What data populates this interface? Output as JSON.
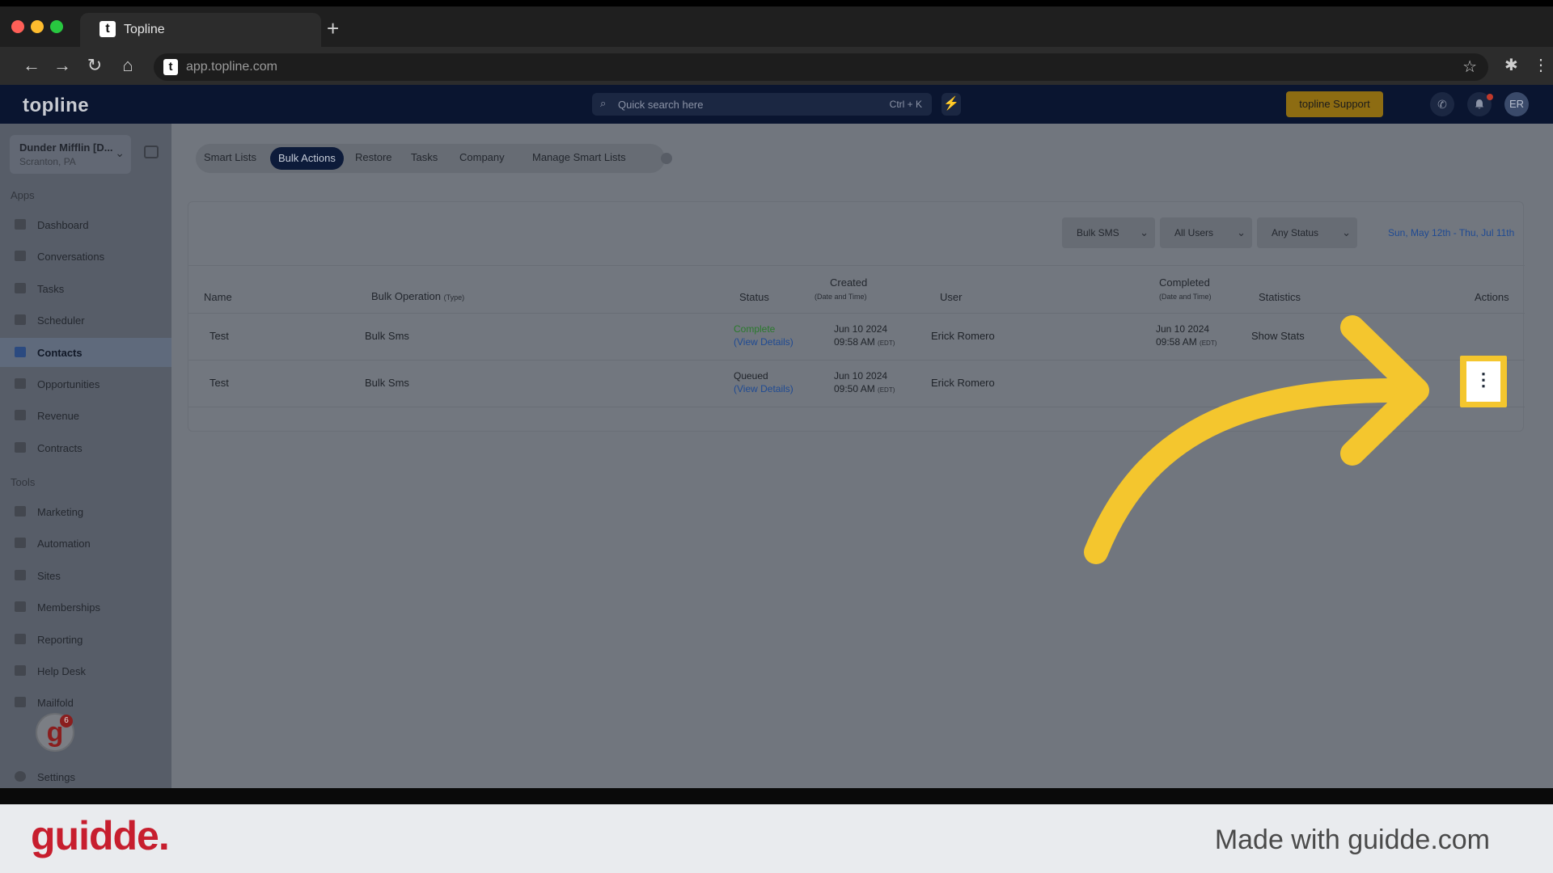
{
  "browser": {
    "tab_title": "Topline",
    "tab_favicon": "t",
    "new_tab": "+",
    "url": "app.topline.com",
    "back": "←",
    "forward": "→",
    "reload": "↻",
    "home": "⌂",
    "star": "☆",
    "extensions": "✱",
    "menu": "⋮"
  },
  "header": {
    "logo": "topline",
    "search_placeholder": "Quick search here",
    "search_shortcut": "Ctrl + K",
    "bolt": "⚡",
    "support_label": "topline Support",
    "avatar_initials": "ER",
    "phone": "✆",
    "bell": "🔔"
  },
  "sidebar": {
    "account_name": "Dunder Mifflin [D...",
    "account_location": "Scranton, PA",
    "apps_label": "Apps",
    "apps": [
      {
        "label": "Dashboard"
      },
      {
        "label": "Conversations"
      },
      {
        "label": "Tasks"
      },
      {
        "label": "Scheduler"
      },
      {
        "label": "Contacts",
        "active": true
      },
      {
        "label": "Opportunities"
      },
      {
        "label": "Revenue"
      },
      {
        "label": "Contracts"
      }
    ],
    "tools_label": "Tools",
    "tools": [
      {
        "label": "Marketing"
      },
      {
        "label": "Automation"
      },
      {
        "label": "Sites"
      },
      {
        "label": "Memberships"
      },
      {
        "label": "Reporting"
      },
      {
        "label": "Help Desk"
      },
      {
        "label": "Mailfold"
      }
    ],
    "settings_label": "Settings",
    "guidde_badge": "g",
    "guidde_count": "6"
  },
  "tabs": [
    "Smart Lists",
    "Bulk Actions",
    "Restore",
    "Tasks",
    "Company",
    "Manage Smart Lists"
  ],
  "active_tab": "Bulk Actions",
  "filters": {
    "type": "Bulk SMS",
    "users": "All Users",
    "status": "Any Status",
    "date_range": "Sun, May 12th - Thu, Jul 11th"
  },
  "table": {
    "headers": {
      "name": "Name",
      "operation": "Bulk Operation",
      "operation_sub": "(Type)",
      "status": "Status",
      "created": "Created",
      "created_sub": "(Date and Time)",
      "user": "User",
      "completed": "Completed",
      "completed_sub": "(Date and Time)",
      "statistics": "Statistics",
      "actions": "Actions"
    },
    "rows": [
      {
        "name": "Test",
        "operation": "Bulk Sms",
        "status": "Complete",
        "details": "(View Details)",
        "created_date": "Jun 10 2024",
        "created_time": "09:58 AM",
        "created_tz": "(EDT)",
        "user": "Erick Romero",
        "completed_date": "Jun 10 2024",
        "completed_time": "09:58 AM",
        "completed_tz": "(EDT)",
        "stats": "Show Stats"
      },
      {
        "name": "Test",
        "operation": "Bulk Sms",
        "status": "Queued",
        "details": "(View Details)",
        "created_date": "Jun 10 2024",
        "created_time": "09:50 AM",
        "created_tz": "(EDT)",
        "user": "Erick Romero",
        "completed_date": "",
        "completed_time": "",
        "completed_tz": "",
        "stats": "",
        "action_icon": "⋮"
      }
    ]
  },
  "footer": {
    "brand": "guidde.",
    "made_with": "Made with guidde.com"
  },
  "colors": {
    "highlight": "#f4c62e",
    "arrow": "#f4c62e",
    "guidde_red": "#c71e2e"
  }
}
